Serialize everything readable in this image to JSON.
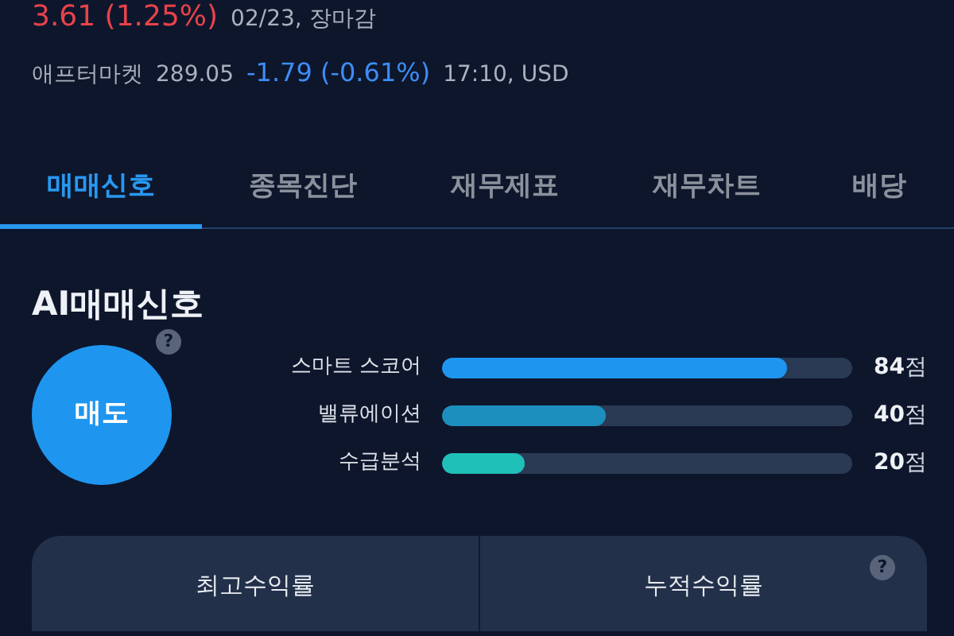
{
  "quote": {
    "change": "3.61 (1.25%)",
    "date": "02/23, 장마감"
  },
  "after_market": {
    "label": "애프터마켓",
    "price": "289.05",
    "change": "-1.79 (-0.61%)",
    "time": "17:10, USD"
  },
  "tabs": [
    {
      "label": "매매신호",
      "selected": true
    },
    {
      "label": "종목진단",
      "selected": false
    },
    {
      "label": "재무제표",
      "selected": false
    },
    {
      "label": "재무차트",
      "selected": false
    },
    {
      "label": "배당",
      "selected": false
    }
  ],
  "section_title": "AI매매신호",
  "signal": {
    "label": "매도",
    "help": "?"
  },
  "scores": [
    {
      "name": "스마트 스코어",
      "level": 0.84,
      "color": "#1e96f0",
      "value": "84",
      "unit": "점"
    },
    {
      "name": "밸류에이션",
      "level": 0.4,
      "color": "#1c8fbf",
      "value": "40",
      "unit": "점"
    },
    {
      "name": "수급분석",
      "level": 0.2,
      "color": "#1fc0b8",
      "value": "20",
      "unit": "점"
    }
  ],
  "returns": {
    "columns": [
      "최고수익률",
      "누적수익률"
    ],
    "help": "?"
  }
}
